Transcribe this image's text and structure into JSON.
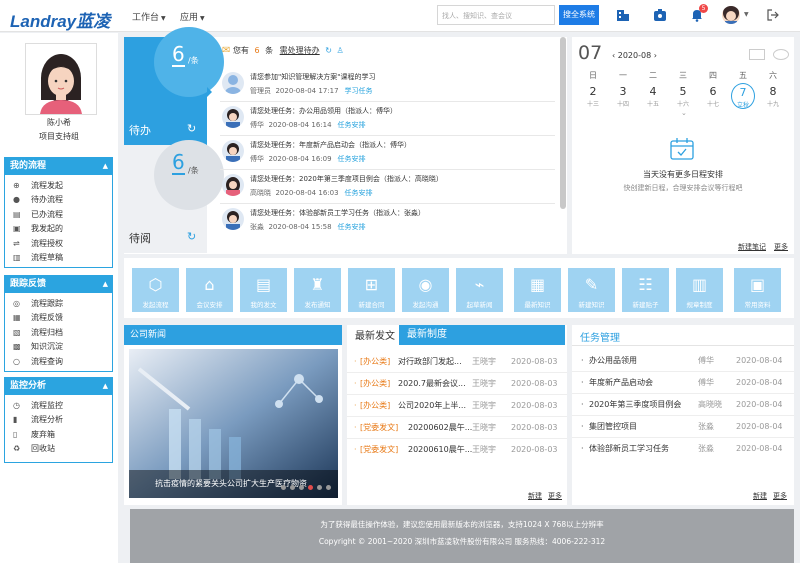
{
  "header": {
    "logo": "Landray蓝凌",
    "nav": [
      {
        "label": "工作台"
      },
      {
        "label": "应用"
      }
    ],
    "search_placeholder": "找人、搜知识、查会议",
    "search_button": "搜全系统",
    "notification_count": "5"
  },
  "profile": {
    "name": "陈小希",
    "role": "项目支持组"
  },
  "sidebar": {
    "sections": [
      {
        "title": "我的流程",
        "items": [
          "流程发起",
          "待办流程",
          "已办流程",
          "我发起的",
          "流程授权",
          "流程草稿"
        ]
      },
      {
        "title": "跟踪反馈",
        "items": [
          "流程跟踪",
          "流程反馈",
          "流程归档",
          "知识沉淀",
          "流程查询"
        ]
      },
      {
        "title": "监控分析",
        "items": [
          "流程监控",
          "流程分析",
          "废弃箱",
          "回收站"
        ]
      }
    ]
  },
  "todo": {
    "pending_count": "6",
    "pending_unit": "/条",
    "pending_label": "待办",
    "read_count": "6",
    "read_unit": "/条",
    "read_label": "待阅",
    "banner_prefix": "您有",
    "banner_count": "6",
    "banner_suffix": "条",
    "banner_link": "需处理待办",
    "items": [
      {
        "title": "请您参加\"知识管理解决方案\"课程的学习",
        "person": "管理员",
        "time": "2020-08-04 17:17",
        "tag": "学习任务"
      },
      {
        "title": "请您处理任务：办公用品领用（指派人：傅华）",
        "person": "傅华",
        "time": "2020-08-04 16:14",
        "tag": "任务安排"
      },
      {
        "title": "请您处理任务：年度新产品启动会（指派人：傅华）",
        "person": "傅华",
        "time": "2020-08-04 16:09",
        "tag": "任务安排"
      },
      {
        "title": "请您处理任务：2020年第三季度项目例会（指派人：高晓晓）",
        "person": "高晓晓",
        "time": "2020-08-04 16:03",
        "tag": "任务安排"
      },
      {
        "title": "请您处理任务：体验部新员工学习任务（指派人：张淼）",
        "person": "张淼",
        "time": "2020-08-04 15:58",
        "tag": "任务安排"
      }
    ]
  },
  "calendar": {
    "day": "07",
    "month": "2020-08",
    "weekdays": [
      "日",
      "一",
      "二",
      "三",
      "四",
      "五",
      "六"
    ],
    "days": [
      {
        "d": "2",
        "l": "十三"
      },
      {
        "d": "3",
        "l": "十四"
      },
      {
        "d": "4",
        "l": "十五"
      },
      {
        "d": "5",
        "l": "十六"
      },
      {
        "d": "6",
        "l": "十七"
      },
      {
        "d": "7",
        "l": "立秋"
      },
      {
        "d": "8",
        "l": "十九"
      }
    ],
    "empty_title": "当天没有更多日程安排",
    "empty_sub": "快创建新日程，合理安排会议等行程吧",
    "new_link": "新建笔记",
    "more_link": "更多"
  },
  "quick": [
    "发起流程",
    "会议安排",
    "我的发文",
    "发布通知",
    "新建合同",
    "发起沟通",
    "起草新闻",
    "最新知识",
    "新建知识",
    "新建贴子",
    "规章制度",
    "常用资料"
  ],
  "news": {
    "header": "公司新闻",
    "caption": "抗击疫情的紧要关头公司扩大生产医疗物资",
    "new": "新建",
    "more": "更多"
  },
  "docs": {
    "tab_a": "最新发文",
    "tab_b": "最新制度",
    "rows": [
      {
        "cat": "[办公类]",
        "title": "对行政部门发起...",
        "person": "王晓宇",
        "date": "2020-08-03"
      },
      {
        "cat": "[办公类]",
        "title": "2020.7最新会议...",
        "person": "王晓宇",
        "date": "2020-08-03"
      },
      {
        "cat": "[办公类]",
        "title": "公司2020年上半...",
        "person": "王晓宇",
        "date": "2020-08-03"
      },
      {
        "cat": "[党委发文]",
        "title": "20200602晨午...",
        "person": "王晓宇",
        "date": "2020-08-03"
      },
      {
        "cat": "[党委发文]",
        "title": "20200610晨午...",
        "person": "王晓宇",
        "date": "2020-08-03"
      }
    ],
    "new": "新建",
    "more": "更多"
  },
  "tasks": {
    "header": "任务管理",
    "rows": [
      {
        "title": "办公用品领用",
        "person": "傅华",
        "date": "2020-08-04"
      },
      {
        "title": "年度新产品启动会",
        "person": "傅华",
        "date": "2020-08-04"
      },
      {
        "title": "2020年第三季度项目例会",
        "person": "高晓晓",
        "date": "2020-08-04"
      },
      {
        "title": "集团管控项目",
        "person": "张淼",
        "date": "2020-08-04"
      },
      {
        "title": "体验部新员工学习任务",
        "person": "张淼",
        "date": "2020-08-04"
      }
    ],
    "new": "新建",
    "more": "更多"
  },
  "footer": {
    "line1": "为了获得最佳操作体验，建议您使用最新版本的浏览器，支持1024 X 768以上分辨率",
    "line2": "Copyright © 2001~2020 深圳市蓝凌软件股份有限公司 服务热线：4006-222-312"
  },
  "colors": {
    "accent": "#2da0e0",
    "brand": "#1d63b4",
    "tile": "#9fd3f2",
    "badge": "#f04848"
  }
}
